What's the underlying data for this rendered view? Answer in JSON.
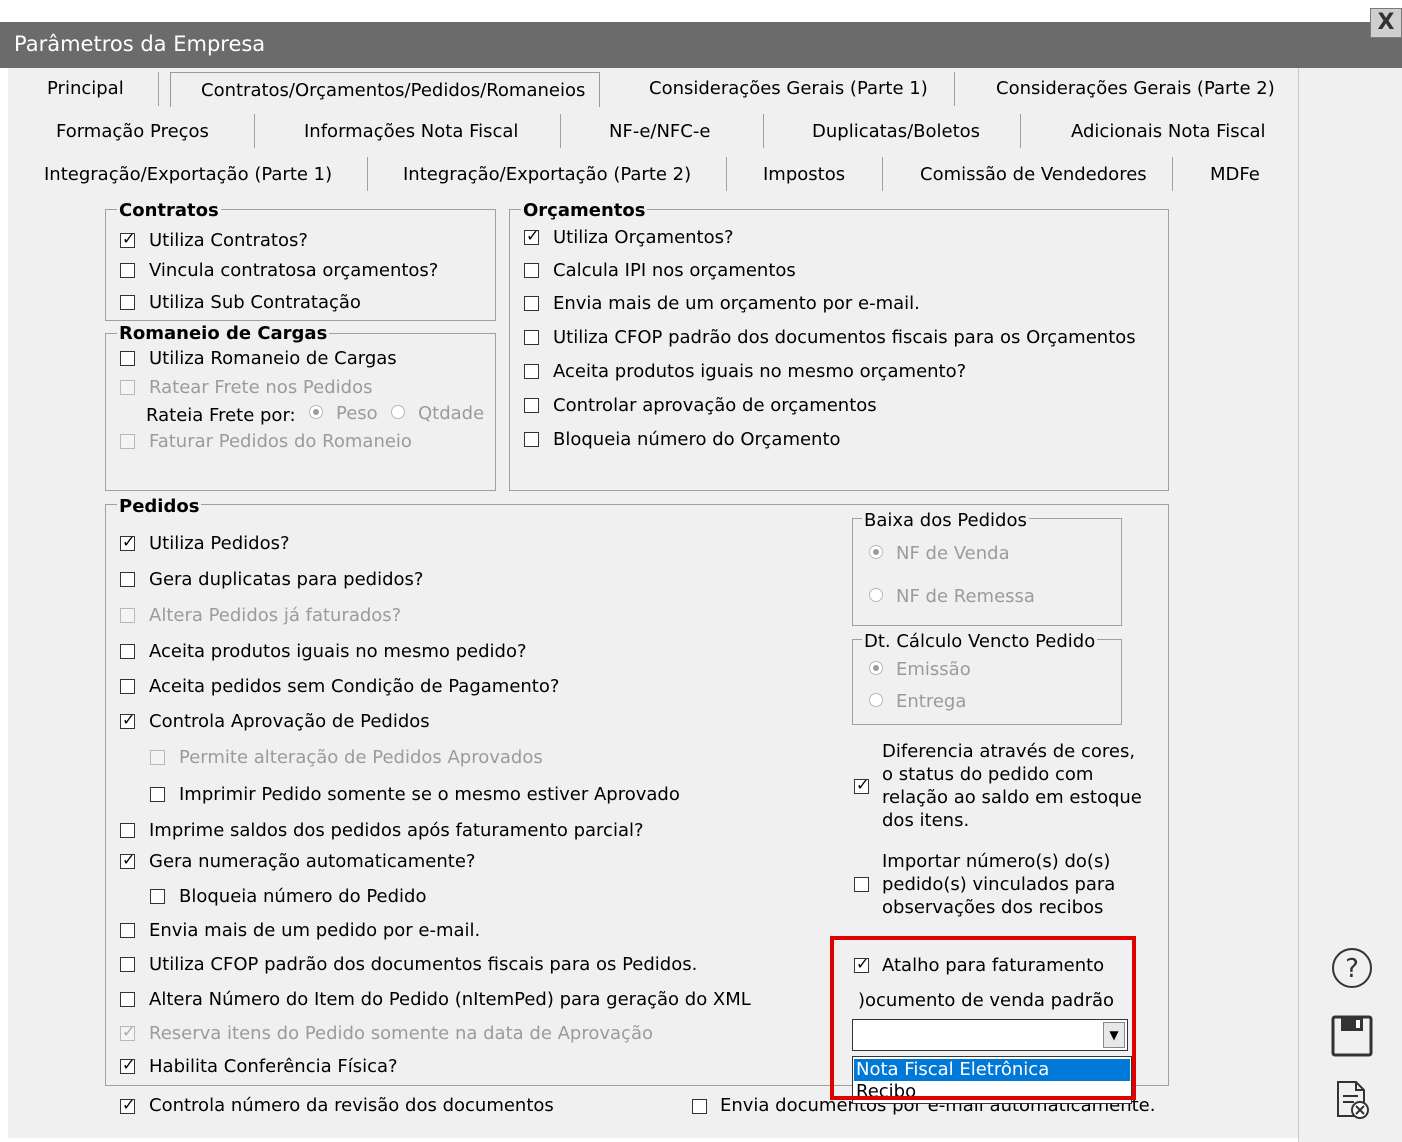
{
  "window": {
    "title": "Parâmetros da Empresa",
    "close_label": "X"
  },
  "tabs": {
    "row1": [
      "Principal",
      "Contratos/Orçamentos/Pedidos/Romaneios",
      "Considerações Gerais (Parte 1)",
      "Considerações Gerais (Parte 2)"
    ],
    "row2": [
      "Formação Preços",
      "Informações Nota Fiscal",
      "NF-e/NFC-e",
      "Duplicatas/Boletos",
      "Adicionais Nota Fiscal"
    ],
    "row3": [
      "Integração/Exportação (Parte 1)",
      "Integração/Exportação (Parte 2)",
      "Impostos",
      "Comissão de Vendedores",
      "MDFe"
    ]
  },
  "contratos": {
    "title": "Contratos",
    "items": [
      {
        "label": "Utiliza Contratos?",
        "checked": true
      },
      {
        "label": "Vincula contratosa orçamentos?",
        "checked": false
      },
      {
        "label": "Utiliza Sub Contratação",
        "checked": false
      }
    ]
  },
  "romaneio": {
    "title": "Romaneio de Cargas",
    "utiliza": "Utiliza Romaneio de Cargas",
    "ratear": "Ratear Frete nos Pedidos",
    "rateia_label": "Rateia Frete por:",
    "peso": "Peso",
    "qtdade": "Qtdade",
    "faturar": "Faturar Pedidos do Romaneio"
  },
  "orcamentos": {
    "title": "Orçamentos",
    "items": [
      {
        "label": "Utiliza Orçamentos?",
        "checked": true
      },
      {
        "label": "Calcula IPI nos orçamentos",
        "checked": false
      },
      {
        "label": "Envia mais de um orçamento por e-mail.",
        "checked": false
      },
      {
        "label": "Utiliza CFOP padrão dos documentos fiscais para os Orçamentos",
        "checked": false
      },
      {
        "label": "Aceita produtos iguais no mesmo orçamento?",
        "checked": false
      },
      {
        "label": "Controlar aprovação de orçamentos",
        "checked": false
      },
      {
        "label": "Bloqueia número do Orçamento",
        "checked": false
      }
    ]
  },
  "pedidos": {
    "title": "Pedidos",
    "items": [
      {
        "label": "Utiliza Pedidos?",
        "checked": true
      },
      {
        "label": "Gera duplicatas para pedidos?",
        "checked": false
      },
      {
        "label": "Altera Pedidos já faturados?",
        "checked": false
      },
      {
        "label": "Aceita produtos iguais no mesmo pedido?",
        "checked": false
      },
      {
        "label": "Aceita pedidos sem Condição de Pagamento?",
        "checked": false
      },
      {
        "label": "Controla Aprovação de Pedidos",
        "checked": true
      },
      {
        "label": "Permite alteração de Pedidos Aprovados",
        "checked": false
      },
      {
        "label": "Imprimir Pedido somente se o mesmo estiver Aprovado",
        "checked": false
      },
      {
        "label": "Imprime saldos dos pedidos após faturamento parcial?",
        "checked": false
      },
      {
        "label": "Gera  numeração automaticamente?",
        "checked": true
      },
      {
        "label": "Bloqueia número do Pedido",
        "checked": false
      },
      {
        "label": "Envia mais de um pedido por e-mail.",
        "checked": false
      },
      {
        "label": "Utiliza CFOP padrão dos documentos fiscais para os Pedidos.",
        "checked": false
      },
      {
        "label": "Altera Número do Item do Pedido (nItemPed) para geração do XML",
        "checked": false
      },
      {
        "label": "Reserva itens do Pedido somente na data de Aprovação",
        "checked": true
      },
      {
        "label": "Habilita Conferência Física?",
        "checked": true
      }
    ],
    "baixa": {
      "title": "Baixa dos Pedidos",
      "opt1": "NF de Venda",
      "opt2": "NF de Remessa"
    },
    "dtcalc": {
      "title": "Dt. Cálculo Vencto Pedido",
      "opt1": "Emissão",
      "opt2": "Entrega"
    },
    "diferencia": {
      "lines": [
        "Diferencia através de cores,",
        "o status do pedido com",
        "relação ao saldo em estoque",
        "dos itens."
      ],
      "checked": true
    },
    "importar": {
      "lines": [
        "Importar número(s) do(s)",
        "pedido(s) vinculados para",
        "observações dos recibos"
      ],
      "checked": false
    },
    "atalho": {
      "label": "Atalho para faturamento",
      "checked": true
    },
    "documento_label": ")ocumento de venda padrão",
    "combo_value": "",
    "options": [
      "Nota Fiscal Eletrônica",
      "Recibo"
    ]
  },
  "bottom": {
    "controla": {
      "label": "Controla número da revisão dos documentos",
      "checked": true
    },
    "envia": {
      "label": "Envia documentos por e-mail automaticamente.",
      "checked": false
    }
  },
  "side": {
    "help_icon": "help-icon",
    "save_icon": "save-icon",
    "cancel_icon": "cancel-doc-icon"
  },
  "colors": {
    "highlight": "#e00000",
    "selection": "#0078d7",
    "titlebar": "#6b6b6b"
  }
}
